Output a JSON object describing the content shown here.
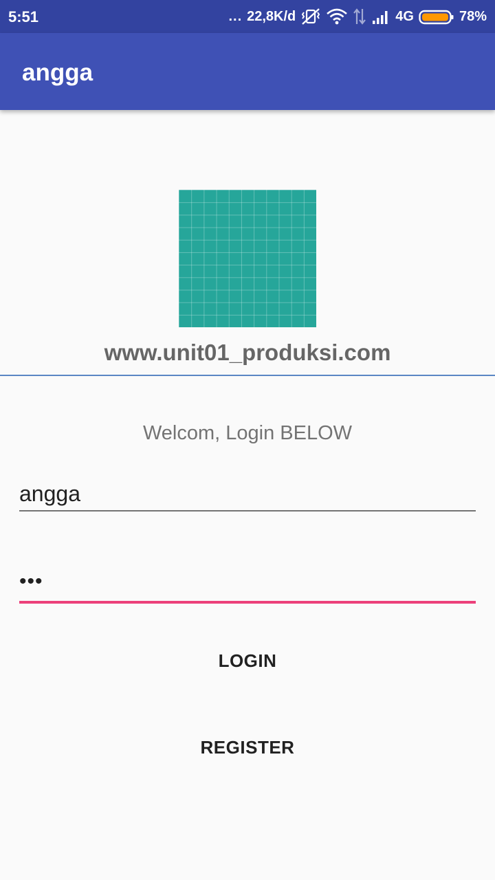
{
  "status_bar": {
    "time": "5:51",
    "dots": "...",
    "network_speed": "22,8K/d",
    "network_type": "4G",
    "battery_percent": "78%",
    "battery_level": 0.78,
    "icons": [
      "vibrate-off-icon",
      "wifi-icon",
      "data-transfer-icon",
      "signal-icon",
      "battery-icon"
    ]
  },
  "app_bar": {
    "title": "angga"
  },
  "colors": {
    "status_bar": "#3343A0",
    "app_bar": "#3F51B5",
    "logo": "#26A69A",
    "accent": "#EC407A",
    "divider": "#5A86C4",
    "background": "#FAFAFA"
  },
  "logo": {
    "icon": "grid-logo-icon"
  },
  "site_url": "www.unit01_produksi.com",
  "welcome_text": "Welcom, Login BELOW",
  "username": {
    "value": "angga"
  },
  "password": {
    "value": "•••"
  },
  "buttons": {
    "login": "LOGIN",
    "register": "REGISTER"
  }
}
